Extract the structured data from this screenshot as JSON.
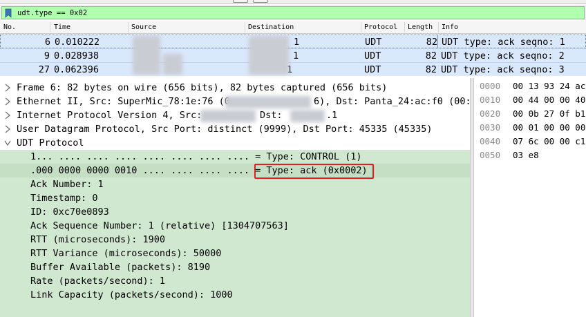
{
  "filter": {
    "value": "udt.type == 0x02",
    "bar_color": "#afffaf"
  },
  "packet_list": {
    "columns": [
      "No.",
      "Time",
      "Source",
      "Destination",
      "Protocol",
      "Length",
      "Info"
    ],
    "rows": [
      {
        "no": "6",
        "time": "0.010222",
        "dst_suffix": "1",
        "protocol": "UDT",
        "length": "82",
        "info": "UDT type: ack   seqno: 1"
      },
      {
        "no": "9",
        "time": "0.028938",
        "dst_suffix": "1",
        "protocol": "UDT",
        "length": "82",
        "info": "UDT type: ack   seqno: 2"
      },
      {
        "no": "27",
        "time": "0.062396",
        "dst_suffix": "1",
        "protocol": "UDT",
        "length": "82",
        "info": "UDT type: ack   seqno: 3"
      }
    ],
    "row_color": "#dae8fc"
  },
  "details": {
    "frame": "Frame 6: 82 bytes on wire (656 bits), 82 bytes captured (656 bits)",
    "ethernet_a": "Ethernet II, Src: SuperMic_78:1e:76 (0",
    "ethernet_b": "6), Dst: Panta_24:ac:f0 (00:1",
    "ip_a": "Internet Protocol Version 4, Src:",
    "ip_b": "Dst:",
    "ip_c": ".1",
    "udp": "User Datagram Protocol, Src Port: distinct (9999), Dst Port: 45335 (45335)",
    "udt": "UDT Protocol",
    "udt_fields": [
      "1... .... .... .... .... .... .... .... = Type: CONTROL (1)",
      ".000 0000 0000 0010 .... .... .... .... = Type: ack (0x0002)",
      "Ack Number: 1",
      "Timestamp: 0",
      "ID: 0xc70e0893",
      "Ack Sequence Number: 1 (relative) [1304707563]",
      "RTT (microseconds): 1900",
      "RTT Variance (microseconds): 50000",
      "Buffer Available (packets): 8190",
      "Rate (packets/second): 1",
      "Link Capacity (packets/second): 1000"
    ],
    "highlight_color": "#e02020",
    "field_color": "#d0e8d0"
  },
  "hex": {
    "rows": [
      {
        "offset": "0000",
        "bytes": "00 13 93 24 ac"
      },
      {
        "offset": "0010",
        "bytes": "00 44 00 00 40"
      },
      {
        "offset": "0020",
        "bytes": "00 0b 27 0f b1"
      },
      {
        "offset": "0030",
        "bytes": "00 01 00 00 00"
      },
      {
        "offset": "0040",
        "bytes": "07 6c 00 00 c1"
      },
      {
        "offset": "0050",
        "bytes": "03 e8"
      }
    ]
  }
}
